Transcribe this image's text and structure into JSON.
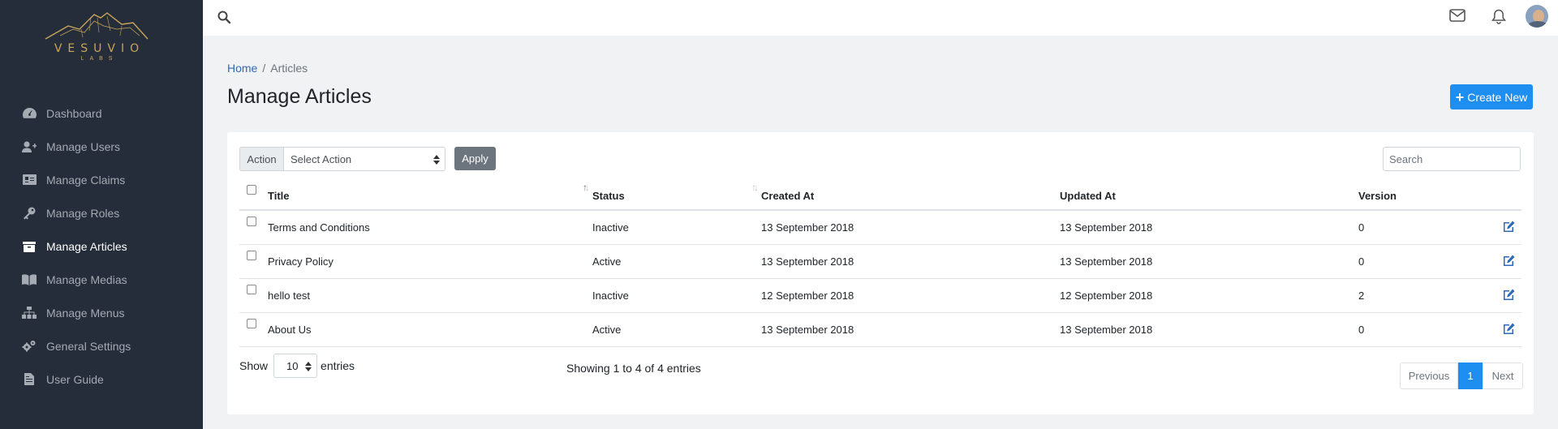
{
  "brand": {
    "name": "VESUVIO",
    "sub": "LABS"
  },
  "sidebar": {
    "items": [
      {
        "label": "Dashboard",
        "icon": "dashboard-icon",
        "active": false
      },
      {
        "label": "Manage Users",
        "icon": "user-plus-icon",
        "active": false
      },
      {
        "label": "Manage Claims",
        "icon": "id-card-icon",
        "active": false
      },
      {
        "label": "Manage Roles",
        "icon": "key-icon",
        "active": false
      },
      {
        "label": "Manage Articles",
        "icon": "archive-icon",
        "active": true
      },
      {
        "label": "Manage Medias",
        "icon": "book-icon",
        "active": false
      },
      {
        "label": "Manage Menus",
        "icon": "sitemap-icon",
        "active": false
      },
      {
        "label": "General Settings",
        "icon": "cogs-icon",
        "active": false
      },
      {
        "label": "User Guide",
        "icon": "file-icon",
        "active": false
      }
    ]
  },
  "topbar": {
    "icons": [
      "search-icon",
      "mail-icon",
      "bell-icon",
      "avatar"
    ]
  },
  "breadcrumb": {
    "home": "Home",
    "separator": "/",
    "current": "Articles"
  },
  "page": {
    "title": "Manage Articles",
    "create_label": "Create New"
  },
  "toolbar": {
    "action_label": "Action",
    "action_select": "Select Action",
    "apply_label": "Apply",
    "search_placeholder": "Search"
  },
  "table": {
    "headers": [
      "Title",
      "Status",
      "Created At",
      "Updated At",
      "Version"
    ],
    "rows": [
      {
        "title": "Terms and Conditions",
        "status": "Inactive",
        "created": "13 September 2018",
        "updated": "13 September 2018",
        "version": "0"
      },
      {
        "title": "Privacy Policy",
        "status": "Active",
        "created": "13 September 2018",
        "updated": "13 September 2018",
        "version": "0"
      },
      {
        "title": "hello test",
        "status": "Inactive",
        "created": "12 September 2018",
        "updated": "12 September 2018",
        "version": "2"
      },
      {
        "title": "About Us",
        "status": "Active",
        "created": "13 September 2018",
        "updated": "13 September 2018",
        "version": "0"
      }
    ]
  },
  "footer": {
    "show_label": "Show",
    "page_length": "10",
    "entries_label": "entries",
    "info": "Showing 1 to 4 of 4 entries",
    "prev": "Previous",
    "current_page": "1",
    "next": "Next"
  },
  "colors": {
    "sidebar_bg": "#252d3a",
    "accent": "#1e8ef0",
    "logo_gold": "#c9a45a",
    "link": "#2d6ab8"
  }
}
